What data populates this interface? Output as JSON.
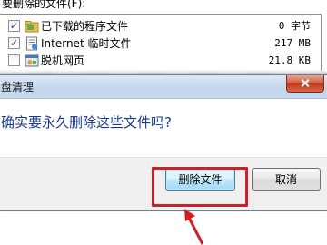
{
  "cleanup": {
    "list_label": "要删除的文件(F):",
    "files": [
      {
        "checked": true,
        "icon": "folder-icon",
        "name": "已下载的程序文件",
        "size": "0 字节"
      },
      {
        "checked": true,
        "icon": "internet-file-icon",
        "name": "Internet 临时文件",
        "size": "217 MB"
      },
      {
        "checked": false,
        "icon": "offline-page-icon",
        "name": "脱机网页",
        "size": "21.8 KB"
      }
    ]
  },
  "dialog": {
    "title": "盘清理",
    "question": "确实要永久删除这些文件吗?",
    "delete_label": "删除文件",
    "cancel_label": "取消",
    "close_icon": "close-icon"
  },
  "annotation": {
    "highlight_color": "#d01f23",
    "arrow_color": "#d01f23"
  },
  "checkmark": "✓"
}
